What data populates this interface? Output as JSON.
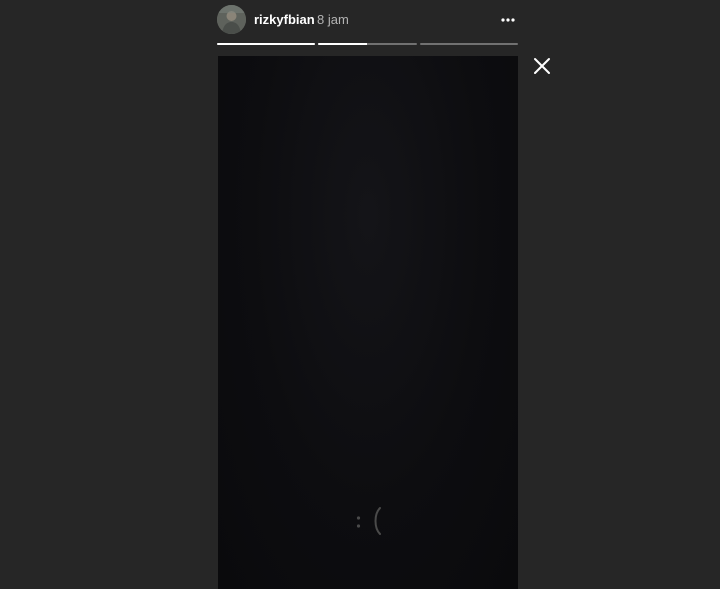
{
  "story": {
    "username": "rizkyfbian",
    "timestamp": "8 jam",
    "progress": [
      1.0,
      0.5,
      0.0
    ]
  },
  "icons": {
    "avatar": "profile-photo",
    "more": "more-options-icon",
    "close": "close-icon",
    "loading": "loading-spinner-icon"
  },
  "colors": {
    "background": "#262626",
    "media": "#0d0d10",
    "text": "#ffffff",
    "muted_text": "#b3b3b3"
  }
}
